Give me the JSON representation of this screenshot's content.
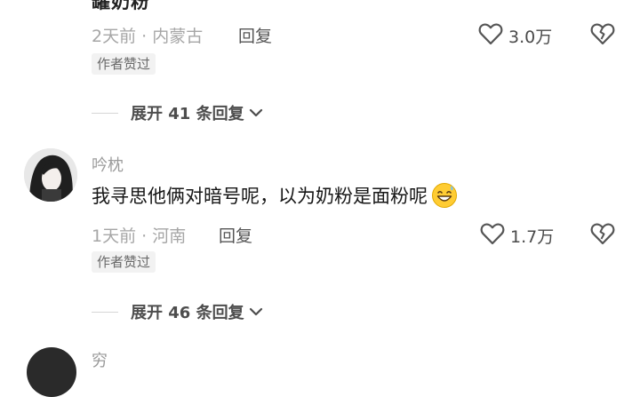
{
  "comment1": {
    "text_cut": "罐奶粉",
    "meta": "2天前 · 内蒙古",
    "reply_label": "回复",
    "likes": "3.0万",
    "badge": "作者赞过",
    "expand_label": "展开 41 条回复"
  },
  "comment2": {
    "username": "吟枕",
    "text": "我寻思他俩对暗号呢，以为奶粉是面粉呢",
    "emoji": "grinning-sweat-emoji",
    "meta": "1天前 · 河南",
    "reply_label": "回复",
    "likes": "1.7万",
    "badge": "作者赞过",
    "expand_label": "展开 46 条回复"
  },
  "comment3": {
    "username_cut": "穷"
  },
  "icons": {
    "like": "heart-outline-icon",
    "dislike": "broken-heart-icon",
    "expand": "chevron-down-icon"
  },
  "colors": {
    "meta_gray": "#a6a6a6",
    "badge_bg": "#f2f2f2",
    "text_dark": "#161616"
  }
}
